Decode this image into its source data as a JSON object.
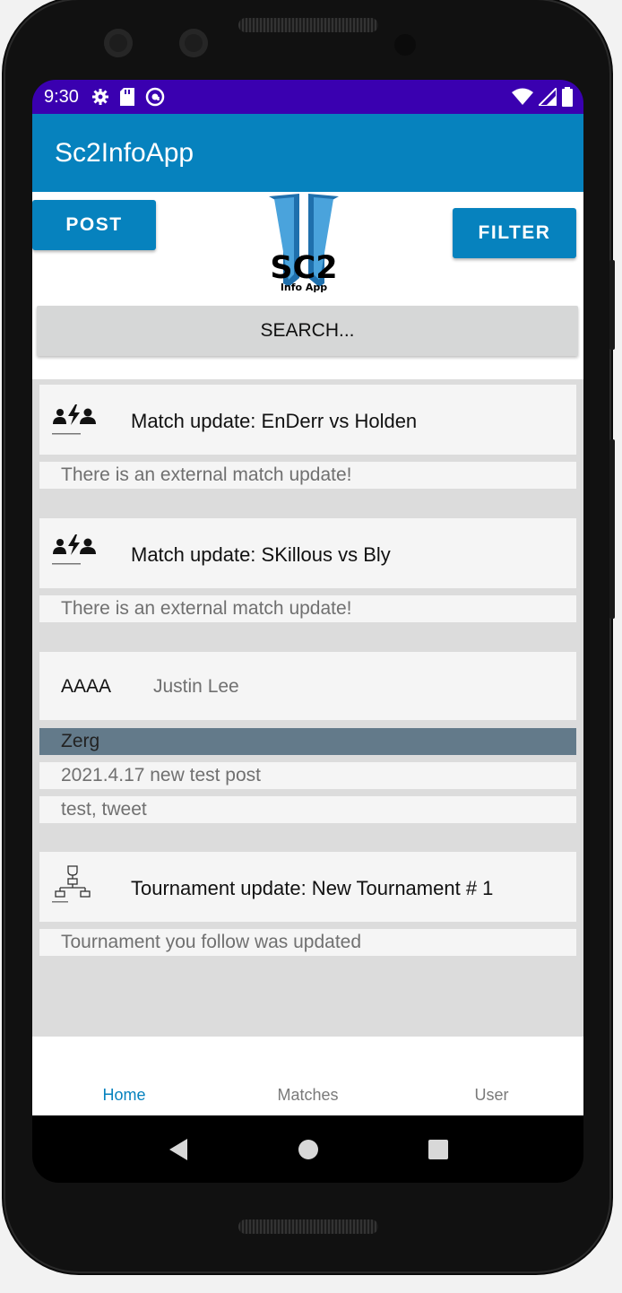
{
  "status": {
    "time": "9:30"
  },
  "appbar": {
    "title": "Sc2InfoApp"
  },
  "header": {
    "post_label": "POST",
    "filter_label": "FILTER",
    "logo_title": "SC2",
    "logo_subtitle": "Info App"
  },
  "search": {
    "label": "SEARCH..."
  },
  "feed": [
    {
      "title": "Match update: EnDerr vs Holden",
      "subtitle": "There is an external match update!",
      "icon": "match-icon"
    },
    {
      "title": "Match update: SKillous vs Bly",
      "subtitle": "There is an external match update!",
      "icon": "match-icon"
    },
    {
      "name": "AAAA",
      "author": "Justin Lee",
      "race": "Zerg",
      "body": "2021.4.17 new test post",
      "tags": "test, tweet"
    },
    {
      "title": "Tournament update: New Tournament # 1",
      "subtitle": "Tournament you follow was updated",
      "icon": "tournament-icon"
    }
  ],
  "nav": {
    "home": "Home",
    "matches": "Matches",
    "user": "User"
  },
  "colors": {
    "accent": "#0682be",
    "statusbar": "#3a00b0",
    "race_bar": "#637a8a"
  }
}
